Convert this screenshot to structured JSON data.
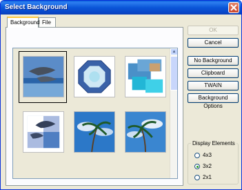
{
  "window": {
    "title": "Select Background"
  },
  "tabs": [
    {
      "label": "Background"
    },
    {
      "label": "File"
    }
  ],
  "gallery": {
    "thumbnails": [
      {
        "label": "dolphins-ocean",
        "selected": true
      },
      {
        "label": "octagon-pattern",
        "selected": false
      },
      {
        "label": "tiled-sea",
        "selected": false
      },
      {
        "label": "dolphin-collage",
        "selected": false
      },
      {
        "label": "palm-trees-1",
        "selected": false
      },
      {
        "label": "palm-trees-2",
        "selected": false
      }
    ]
  },
  "buttons": {
    "ok": "OK",
    "cancel": "Cancel",
    "no_background": "No Background",
    "clipboard": "Clipboard",
    "twain": "TWAIN",
    "background_options": "Background Options"
  },
  "display_elements": {
    "legend": "Display Elements",
    "options": [
      {
        "label": "4x3",
        "checked": false
      },
      {
        "label": "3x2",
        "checked": true
      },
      {
        "label": "2x1",
        "checked": false
      }
    ]
  }
}
